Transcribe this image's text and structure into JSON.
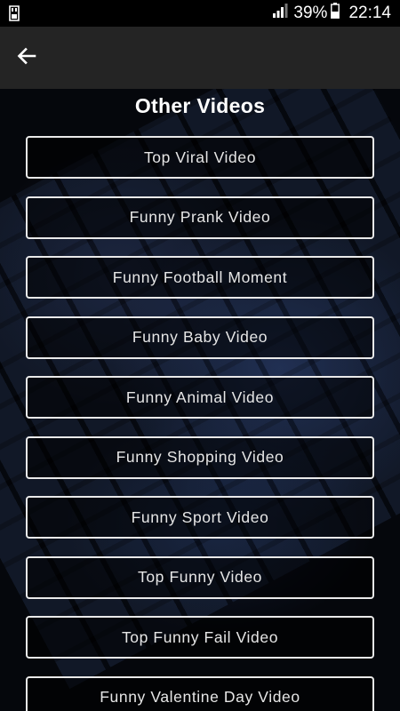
{
  "status_bar": {
    "notification_icon": "usb-storage-icon",
    "signal_icon": "signal-icon",
    "battery_percent": "39%",
    "battery_icon": "battery-icon",
    "time": "22:14"
  },
  "toolbar": {
    "back_icon": "arrow-back-icon"
  },
  "page": {
    "title": "Other Videos"
  },
  "videos": [
    {
      "label": "Top Viral Video"
    },
    {
      "label": "Funny Prank Video"
    },
    {
      "label": "Funny Football Moment"
    },
    {
      "label": "Funny Baby Video"
    },
    {
      "label": "Funny Animal Video"
    },
    {
      "label": "Funny Shopping Video"
    },
    {
      "label": "Funny Sport Video"
    },
    {
      "label": "Top Funny Video"
    },
    {
      "label": "Top Funny Fail Video"
    },
    {
      "label": "Funny Valentine Day Video"
    }
  ],
  "colors": {
    "toolbar_bg": "#242424",
    "button_border": "#e9e9e9",
    "text": "#ffffff"
  }
}
